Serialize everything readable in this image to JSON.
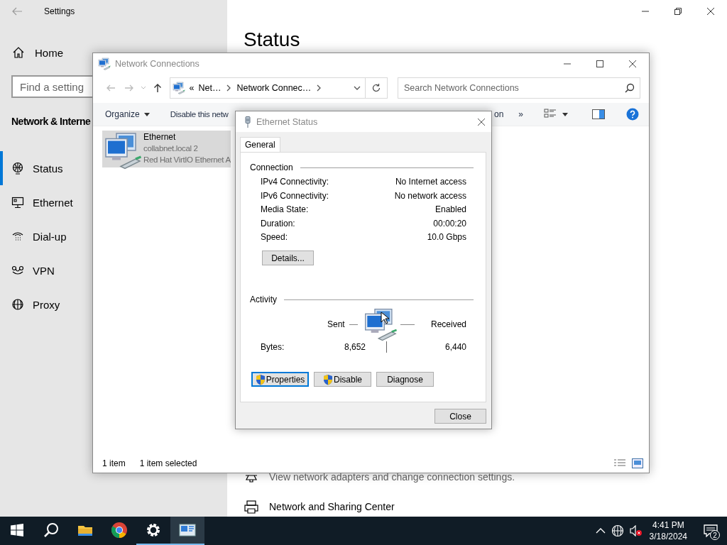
{
  "settings_window": {
    "title": "Settings",
    "home": "Home",
    "search": {
      "placeholder": "Find a setting"
    },
    "section_title": "Network & Interne",
    "nav": [
      {
        "label": "Status",
        "selected": true
      },
      {
        "label": "Ethernet",
        "selected": false
      },
      {
        "label": "Dial-up",
        "selected": false
      },
      {
        "label": "VPN",
        "selected": false
      },
      {
        "label": "Proxy",
        "selected": false
      }
    ],
    "page_title": "Status",
    "entries": [
      {
        "kind": "description",
        "text": "View network adapters and change connection settings."
      },
      {
        "kind": "link",
        "text": "Network and Sharing Center"
      }
    ]
  },
  "network_connections": {
    "title": "Network Connections",
    "address": {
      "overflow": "«",
      "parts": [
        "Net…",
        "Network Connec…"
      ]
    },
    "search": {
      "placeholder": "Search Network Connections"
    },
    "toolbar": [
      {
        "kind": "menu",
        "label": "Organize"
      },
      {
        "kind": "command",
        "label": "Disable this netw"
      },
      {
        "kind": "command",
        "label": "on"
      },
      {
        "kind": "overflow",
        "label": "»"
      }
    ],
    "items": [
      {
        "name": "Ethernet",
        "lines": [
          "collabnet.local 2",
          "Red Hat VirtIO Ethernet A"
        ],
        "selected": true
      }
    ],
    "status_bar": [
      "1 item",
      "1 item selected"
    ]
  },
  "ethernet_status": {
    "title": "Ethernet Status",
    "tabs": [
      {
        "label": "General",
        "selected": true
      }
    ],
    "connection": {
      "heading": "Connection",
      "rows": [
        {
          "label": "IPv4 Connectivity:",
          "value": "No Internet access"
        },
        {
          "label": "IPv6 Connectivity:",
          "value": "No network access"
        },
        {
          "label": "Media State:",
          "value": "Enabled"
        },
        {
          "label": "Duration:",
          "value": "00:00:20"
        },
        {
          "label": "Speed:",
          "value": "10.0 Gbps"
        }
      ]
    },
    "details_button": "Details...",
    "activity": {
      "heading": "Activity",
      "sent_label": "Sent",
      "received_label": "Received",
      "bytes_label": "Bytes:",
      "sent": "8,652",
      "received": "6,440"
    },
    "buttons": [
      {
        "label": "Properties",
        "shield": true,
        "focused": true
      },
      {
        "label": "Disable",
        "shield": true,
        "focused": false
      },
      {
        "label": "Diagnose",
        "shield": false,
        "focused": false
      }
    ],
    "close_button": "Close"
  },
  "taskbar": {
    "apps": [
      {
        "kind": "explorer",
        "running": false,
        "selected": false
      },
      {
        "kind": "chrome",
        "running": false,
        "selected": false
      },
      {
        "kind": "settings",
        "running": true,
        "selected": false
      },
      {
        "kind": "network",
        "running": true,
        "selected": true
      }
    ],
    "tray": {
      "time": "4:41 PM",
      "date": "3/18/2024",
      "notifications": "2"
    }
  }
}
